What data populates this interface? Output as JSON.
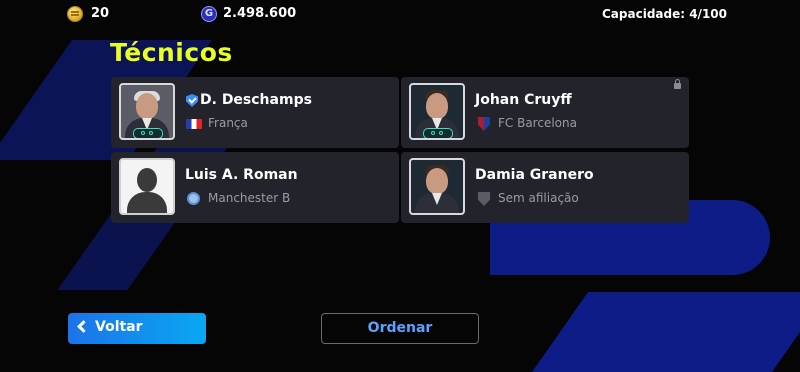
{
  "currency": {
    "coins": "20",
    "gp": "2.498.600",
    "gp_symbol": "G"
  },
  "capacity": "Capacidade: 4/100",
  "section_title": "Técnicos",
  "managers": [
    {
      "name": "D. Deschamps",
      "club": "França",
      "club_icon": "france-flag-icon",
      "verified": true,
      "locked": false
    },
    {
      "name": "Johan Cruyff",
      "club": "FC Barcelona",
      "club_icon": "fc-barcelona-crest-icon",
      "verified": false,
      "locked": true
    },
    {
      "name": "Luis A. Roman",
      "club": "Manchester B",
      "club_icon": "manchester-b-crest-icon",
      "verified": false,
      "locked": false
    },
    {
      "name": "Damia Granero",
      "club": "Sem afiliação",
      "club_icon": "no-affiliation-shield-icon",
      "verified": false,
      "locked": false
    }
  ],
  "buttons": {
    "back": "Voltar",
    "sort": "Ordenar"
  },
  "colors": {
    "title_yellow": "#e9ff1f",
    "card_bg": "#22232b",
    "back_button": "#1b74e8",
    "sort_text": "#5aa3ff"
  }
}
